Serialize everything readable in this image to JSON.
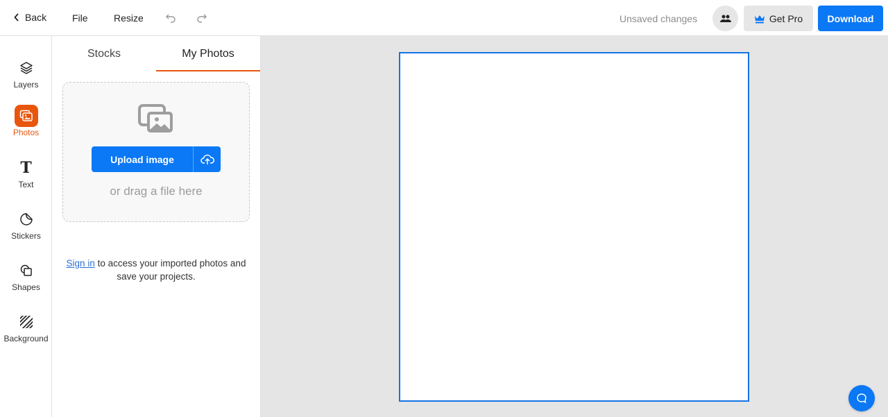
{
  "topbar": {
    "back_label": "Back",
    "file_label": "File",
    "resize_label": "Resize",
    "undo_icon": "undo-icon",
    "redo_icon": "redo-icon",
    "status": "Unsaved changes",
    "collab_icon": "users-icon",
    "get_pro_label": "Get Pro",
    "download_label": "Download"
  },
  "rail": {
    "items": [
      {
        "label": "Layers",
        "icon": "layers-icon",
        "active": false
      },
      {
        "label": "Photos",
        "icon": "photos-icon",
        "active": true
      },
      {
        "label": "Text",
        "icon": "text-icon",
        "active": false
      },
      {
        "label": "Stickers",
        "icon": "sticker-icon",
        "active": false
      },
      {
        "label": "Shapes",
        "icon": "shapes-icon",
        "active": false
      },
      {
        "label": "Background",
        "icon": "background-icon",
        "active": false
      }
    ]
  },
  "panel": {
    "tabs": [
      {
        "label": "Stocks",
        "active": false
      },
      {
        "label": "My Photos",
        "active": true
      }
    ],
    "upload_label": "Upload image",
    "drag_text": "or drag a file here",
    "signin_link": "Sign in",
    "signin_rest": " to access your imported photos and save your projects."
  },
  "colors": {
    "accent": "#0b78f5",
    "active_orange": "#e8560d",
    "artboard_border": "#1473e6"
  }
}
